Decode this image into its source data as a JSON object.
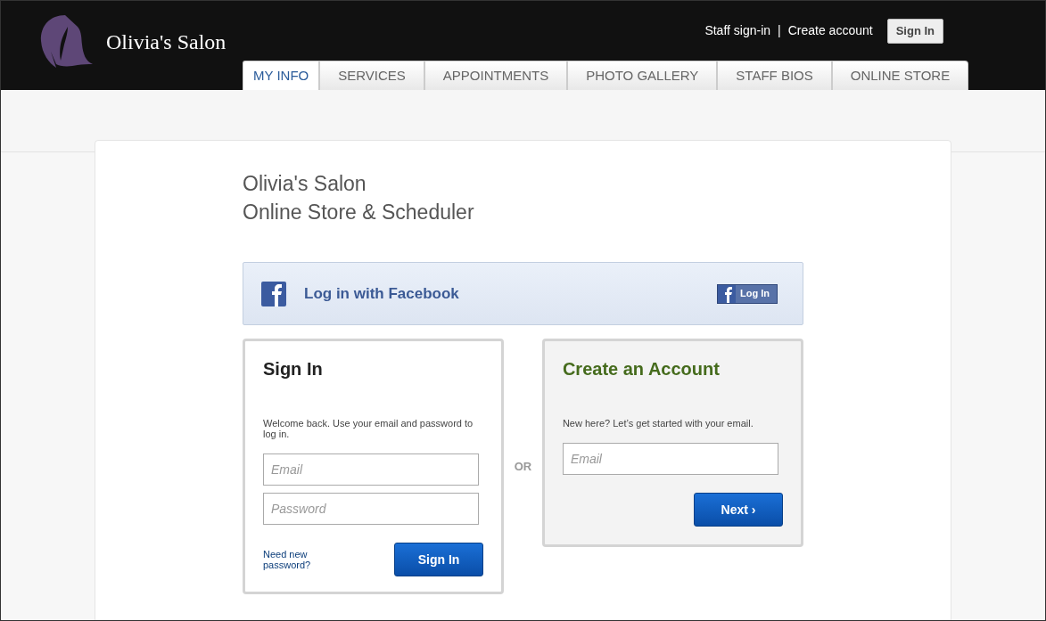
{
  "brand": {
    "name": "Olivia's Salon"
  },
  "top_links": [
    "Staff sign-in",
    "Create account"
  ],
  "link_separator": "|",
  "top_button": "Sign In",
  "tabs": [
    {
      "label": "MY INFO",
      "selected": true
    },
    {
      "label": "SERVICES",
      "selected": false
    },
    {
      "label": "APPOINTMENTS",
      "selected": false
    },
    {
      "label": "PHOTO GALLERY",
      "selected": false
    },
    {
      "label": "STAFF BIOS",
      "selected": false
    },
    {
      "label": "ONLINE STORE",
      "selected": false
    }
  ],
  "heading": [
    "Olivia's Salon",
    "Online Store & Scheduler"
  ],
  "facebook": {
    "label": "Log in with Facebook",
    "button": "Log In"
  },
  "sign_in": {
    "title": "Sign In",
    "intro": "Welcome back. Use your email and password to log in.",
    "email": {
      "placeholder": "Email"
    },
    "password": {
      "placeholder": "Password"
    },
    "forgot": "Need new password?",
    "button": "Sign In"
  },
  "separator": "OR",
  "create": {
    "title": "Create an Account",
    "intro": "New here? Let’s get started with your email.",
    "email": {
      "placeholder": "Email"
    },
    "button": "Next ›"
  }
}
